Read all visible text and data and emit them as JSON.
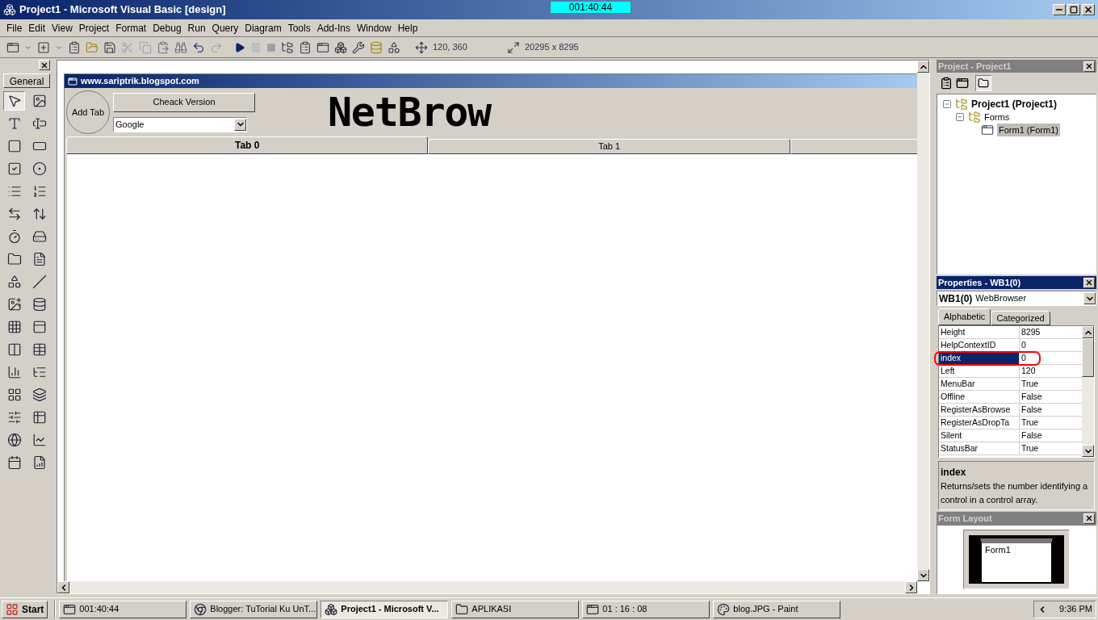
{
  "window": {
    "title": "Project1 - Microsoft Visual Basic [design]"
  },
  "timer_overlay": "001:40:44",
  "menu": [
    "File",
    "Edit",
    "View",
    "Project",
    "Format",
    "Debug",
    "Run",
    "Query",
    "Diagram",
    "Tools",
    "Add-Ins",
    "Window",
    "Help"
  ],
  "toolbar": {
    "position": "120, 360",
    "size": "20295 x 8295"
  },
  "toolbox": {
    "tab": "General",
    "tools": [
      {
        "kind": "pointer",
        "selected": true
      },
      {
        "kind": "picture",
        "selected": false
      },
      {
        "kind": "label",
        "selected": false
      },
      {
        "kind": "textbox",
        "selected": false
      },
      {
        "kind": "frame",
        "selected": false
      },
      {
        "kind": "command",
        "selected": false
      },
      {
        "kind": "checkbox",
        "selected": false
      },
      {
        "kind": "option",
        "selected": false
      },
      {
        "kind": "combo",
        "selected": false
      },
      {
        "kind": "list",
        "selected": false
      },
      {
        "kind": "hscroll",
        "selected": false
      },
      {
        "kind": "vscroll",
        "selected": false
      },
      {
        "kind": "timer",
        "selected": false
      },
      {
        "kind": "drive",
        "selected": false
      },
      {
        "kind": "folder",
        "selected": false
      },
      {
        "kind": "file",
        "selected": false
      },
      {
        "kind": "shape",
        "selected": false
      },
      {
        "kind": "line",
        "selected": false
      },
      {
        "kind": "image",
        "selected": false
      },
      {
        "kind": "data",
        "selected": false
      },
      {
        "kind": "ole",
        "selected": false
      },
      {
        "kind": "tab",
        "selected": false
      },
      {
        "kind": "columns",
        "selected": false
      },
      {
        "kind": "grid",
        "selected": false
      },
      {
        "kind": "progress",
        "selected": false
      },
      {
        "kind": "tree",
        "selected": false
      },
      {
        "kind": "icons",
        "selected": false
      },
      {
        "kind": "layers",
        "selected": false
      },
      {
        "kind": "slider",
        "selected": false
      },
      {
        "kind": "table",
        "selected": false
      },
      {
        "kind": "globe",
        "selected": false
      },
      {
        "kind": "chart",
        "selected": false
      },
      {
        "kind": "calendar",
        "selected": false
      },
      {
        "kind": "report",
        "selected": false
      }
    ]
  },
  "form": {
    "title": "www.sariptrik.blogspot.com",
    "add_tab": "Add Tab",
    "check_button": "Cheack Version",
    "combo": "Google",
    "logo": "NetBrow",
    "tabs": [
      {
        "label": "Tab 0",
        "selected": true
      },
      {
        "label": "Tab 1",
        "selected": false
      }
    ]
  },
  "project": {
    "title": "Project - Project1",
    "tree": [
      {
        "label": "Project1 (Project1)",
        "expanded": true,
        "children": [
          {
            "label": "Forms",
            "expanded": true,
            "children": [
              {
                "label": "Form1 (Form1)",
                "selected": true
              }
            ]
          }
        ]
      }
    ]
  },
  "properties": {
    "title": "Properties - WB1(0)",
    "object_name": "WB1(0)",
    "object_type": "WebBrowser",
    "tabs": [
      {
        "label": "Alphabetic",
        "selected": true
      },
      {
        "label": "Categorized",
        "selected": false
      }
    ],
    "rows": [
      {
        "name": "Height",
        "value": "8295",
        "selected": false
      },
      {
        "name": "HelpContextID",
        "value": "0",
        "selected": false
      },
      {
        "name": "index",
        "value": "0",
        "selected": true
      },
      {
        "name": "Left",
        "value": "120",
        "selected": false
      },
      {
        "name": "MenuBar",
        "value": "True",
        "selected": false
      },
      {
        "name": "Offline",
        "value": "False",
        "selected": false
      },
      {
        "name": "RegisterAsBrowse",
        "value": "False",
        "selected": false
      },
      {
        "name": "RegisterAsDropTa",
        "value": "True",
        "selected": false
      },
      {
        "name": "Silent",
        "value": "False",
        "selected": false
      },
      {
        "name": "StatusBar",
        "value": "True",
        "selected": false
      }
    ],
    "description_title": "index",
    "description": "Returns/sets the number identifying a control in a control array."
  },
  "form_layout": {
    "title": "Form Layout",
    "form_label": "Form1"
  },
  "taskbar": {
    "start": "Start",
    "items": [
      {
        "label": "001:40:44",
        "kind": "window",
        "selected": false
      },
      {
        "label": "Blogger: TuTorial Ku UnT...",
        "kind": "browser",
        "selected": false
      },
      {
        "label": "Project1 - Microsoft V...",
        "kind": "vb",
        "selected": true
      },
      {
        "label": "APLIKASI",
        "kind": "folder",
        "selected": false
      },
      {
        "label": "01 : 16 : 08",
        "kind": "window",
        "selected": false
      },
      {
        "label": "blog.JPG - Paint",
        "kind": "paint",
        "selected": false
      }
    ],
    "clock": "9:36 PM"
  }
}
